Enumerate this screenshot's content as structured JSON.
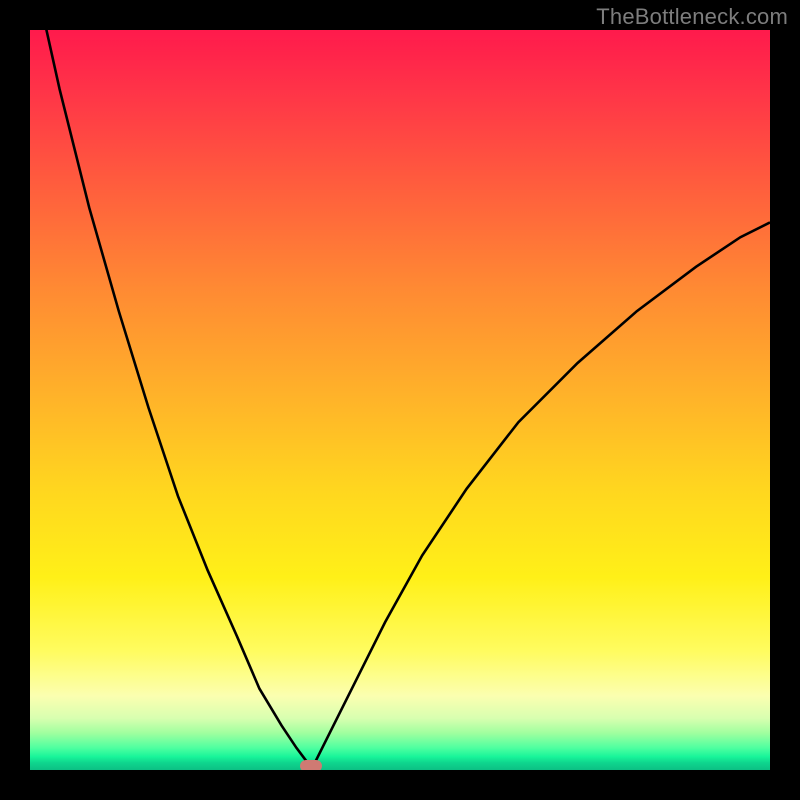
{
  "watermark": {
    "text": "TheBottleneck.com"
  },
  "chart_data": {
    "type": "line",
    "title": "",
    "xlabel": "",
    "ylabel": "",
    "xlim": [
      0,
      100
    ],
    "ylim": [
      0,
      100
    ],
    "legend": false,
    "grid": false,
    "background_gradient": {
      "top": "#ff1a4c",
      "mid": "#ffd61f",
      "bottom": "#0cbf84"
    },
    "marker": {
      "x": 38,
      "y": 0,
      "color": "#cf7a73"
    },
    "series": [
      {
        "name": "left-branch",
        "x": [
          0,
          4,
          8,
          12,
          16,
          20,
          24,
          28,
          31,
          34,
          36,
          37.5,
          38
        ],
        "y": [
          110,
          92,
          76,
          62,
          49,
          37,
          27,
          18,
          11,
          6,
          3,
          1,
          0
        ]
      },
      {
        "name": "right-branch",
        "x": [
          38,
          39,
          41,
          44,
          48,
          53,
          59,
          66,
          74,
          82,
          90,
          96,
          100
        ],
        "y": [
          0,
          2,
          6,
          12,
          20,
          29,
          38,
          47,
          55,
          62,
          68,
          72,
          74
        ]
      }
    ],
    "annotations": []
  }
}
